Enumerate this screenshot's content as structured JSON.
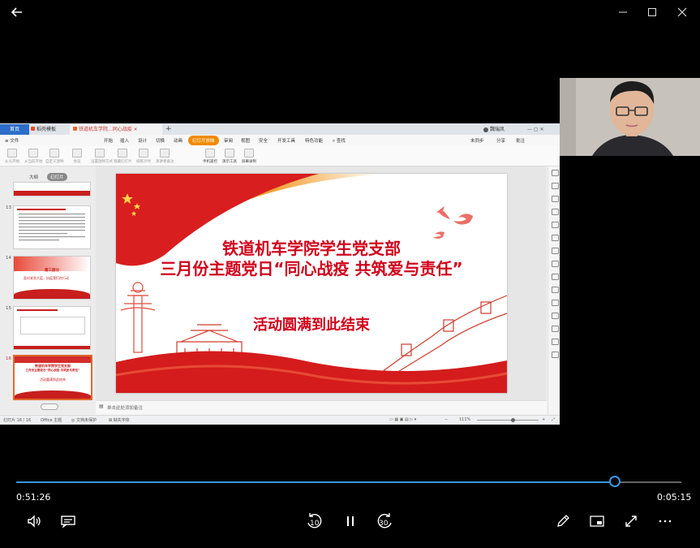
{
  "player": {
    "elapsed": "0:51:26",
    "remaining": "0:05:15",
    "progress_fraction": 0.9,
    "skip_back_label": "10",
    "skip_forward_label": "30",
    "accent": "#3a96dd"
  },
  "app": {
    "tabs": [
      "首页",
      "稻壳模板",
      "铁道机车学院...同心战疫"
    ],
    "menu": [
      "文件",
      "开始",
      "插入",
      "设计",
      "切换",
      "动画",
      "幻灯片放映",
      "审阅",
      "视图",
      "安全",
      "开发工具",
      "特色功能",
      "查找"
    ],
    "menu_right": [
      "未同步",
      "分享",
      "批注"
    ],
    "user_name": "魏瑞凤",
    "toolbar": [
      "从头开始",
      "从当前开始",
      "自定义放映",
      "会议",
      "设置放映方式",
      "隐藏幻灯片",
      "排练计时",
      "演讲者备注",
      "手机遥控",
      "演示工具",
      "屏幕录制"
    ],
    "pane_tabs": [
      "大纲",
      "幻灯片"
    ],
    "slide_numbers": [
      "13",
      "14",
      "15",
      "16"
    ],
    "thumb14_line1": "第三部分",
    "thumb14_line2": "面对紧急大疫，抗疫我们在行动",
    "thumb16_line1": "铁道机车学院学生党支部",
    "thumb16_line2": "三月份主题党日“同心战疫 共筑爱与责任”",
    "thumb16_line3": "活动圆满到此结束",
    "notes_placeholder": "单击此处添加备注",
    "status_left": [
      "幻灯片 16 / 16",
      "Office 主题",
      "文档未保护",
      "缺失字体"
    ],
    "zoom": "111%"
  },
  "slide": {
    "title_line1": "铁道机车学院学生党支部",
    "title_line2": "三月份主题党日“同心战疫 共筑爱与责任”",
    "subtitle": "活动圆满到此结束",
    "red": "#d0021b"
  }
}
